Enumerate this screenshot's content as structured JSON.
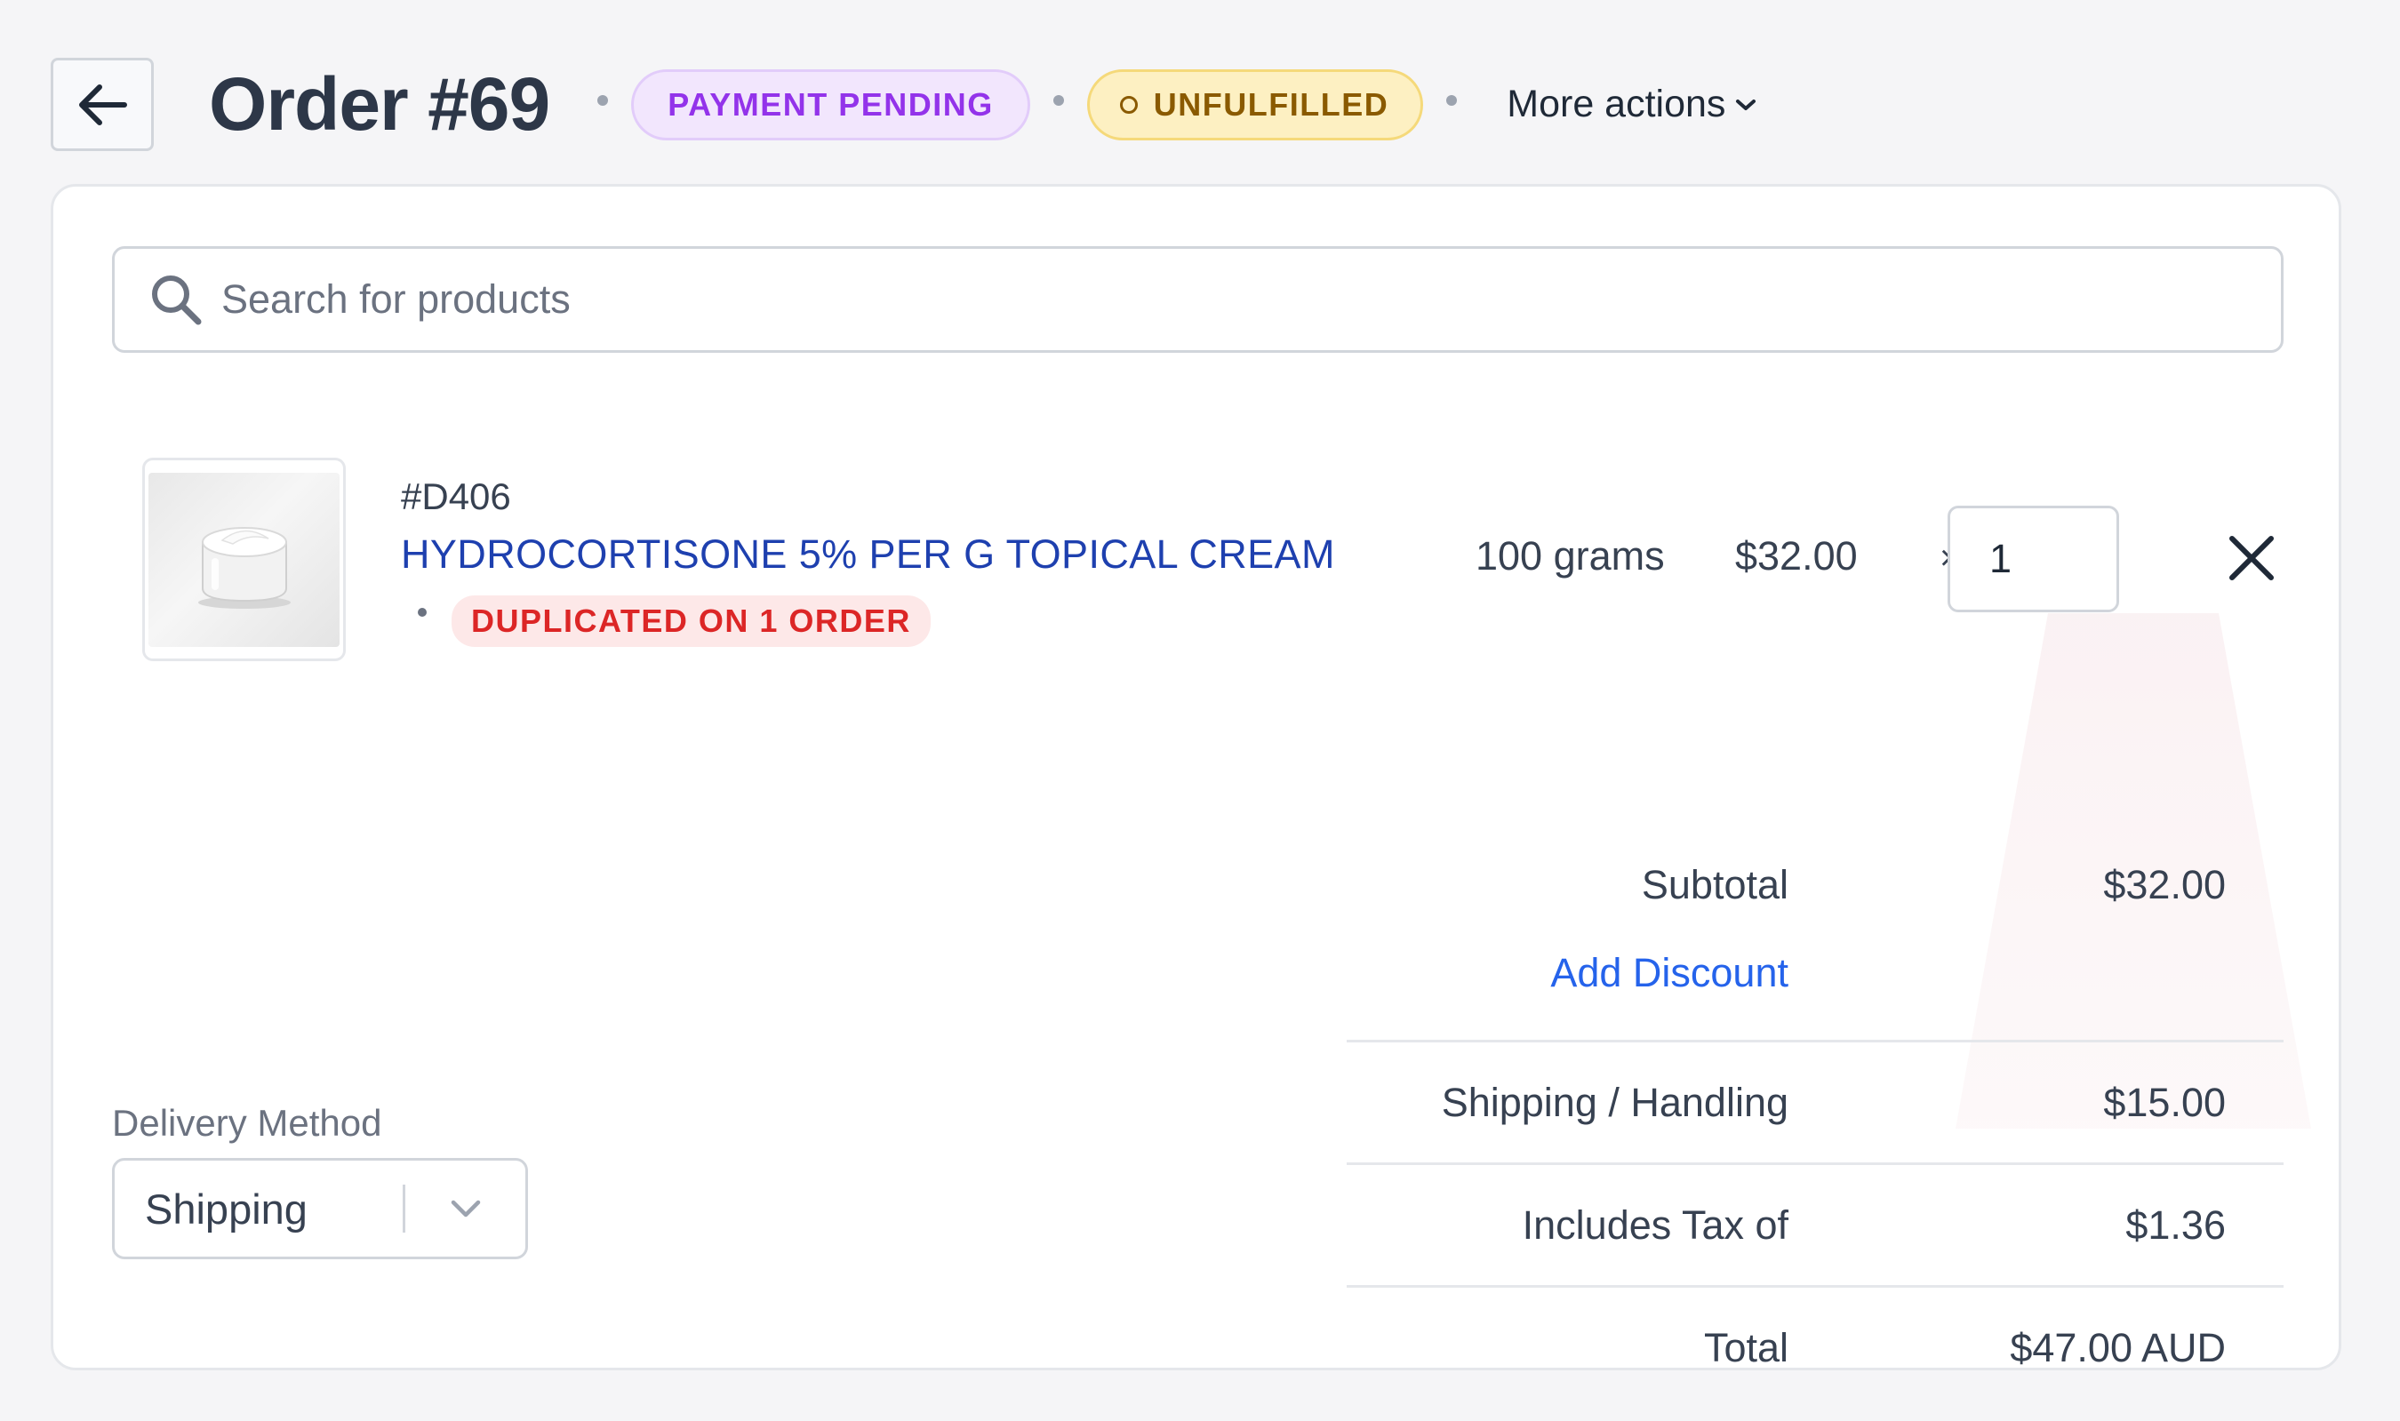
{
  "header": {
    "title": "Order #69",
    "payment_status": "PAYMENT PENDING",
    "fulfillment_status": "UNFULFILLED",
    "more_actions": "More actions"
  },
  "search": {
    "placeholder": "Search for products"
  },
  "line_item": {
    "sku": "#D406",
    "name": "HYDROCORTISONE 5% PER G TOPICAL CREAM",
    "warning": "DUPLICATED ON 1 ORDER",
    "unit": "100 grams",
    "price": "$32.00",
    "times": "×",
    "quantity": "1"
  },
  "totals": {
    "subtotal_label": "Subtotal",
    "subtotal_value": "$32.00",
    "add_discount": "Add Discount",
    "shipping_label": "Shipping / Handling",
    "shipping_value": "$15.00",
    "tax_label": "Includes Tax of",
    "tax_value": "$1.36",
    "total_label": "Total",
    "total_value": "$47.00 AUD"
  },
  "delivery": {
    "label": "Delivery Method",
    "selected": "Shipping"
  },
  "colors": {
    "payment_badge": "#9333ea",
    "fulfill_badge": "#8a5a00",
    "link": "#2563eb",
    "warning": "#dc2626"
  }
}
